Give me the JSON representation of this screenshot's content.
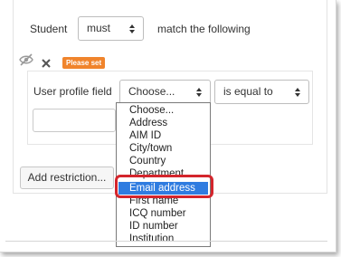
{
  "row1": {
    "label": "Student",
    "select_value": "must",
    "suffix": "match the following"
  },
  "controls": {
    "eye_icon": "eye-slash-icon",
    "delete_icon": "close-icon",
    "badge": "Please set"
  },
  "condition": {
    "field_label": "User profile field",
    "field_select": "Choose...",
    "operator_select": "is equal to"
  },
  "add_button": "Add restriction...",
  "dropdown": {
    "options": [
      "Choose...",
      "Address",
      "AIM ID",
      "City/town",
      "Country",
      "Department",
      "Email address",
      "First name",
      "ICQ number",
      "ID number",
      "Institution"
    ],
    "selected": "Email address"
  },
  "colors": {
    "badge": "#f0842c",
    "selected_option": "#2f7ce0",
    "highlight": "#d4252c"
  }
}
